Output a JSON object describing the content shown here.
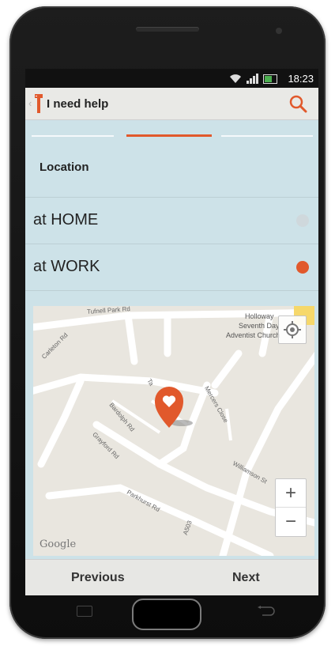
{
  "status_bar": {
    "time": "18:23"
  },
  "app_bar": {
    "back_glyph": "‹",
    "title": "I need help",
    "logo_icon": "help-logo-icon",
    "search_icon": "search-icon"
  },
  "tabs": {
    "active_index": 1,
    "count": 3
  },
  "section": {
    "title": "Location"
  },
  "options": [
    {
      "label": "at HOME",
      "selected": false
    },
    {
      "label": "at WORK",
      "selected": true
    }
  ],
  "map": {
    "labels": {
      "tufnell": "Tufnell Park Rd",
      "carleton": "Carleton Rd",
      "holloway_1": "Holloway",
      "holloway_2": "Seventh Day",
      "holloway_3": "Adventist Church",
      "bardsley": "Bardolph Rd",
      "grayford": "Grayford Rd",
      "parkhurst": "Parkhurst Rd",
      "mercers": "Mercers Close",
      "williamson": "Williamson St",
      "a503": "A503",
      "ta": "Ta"
    },
    "attribution": "Google",
    "zoom_in": "+",
    "zoom_out": "−"
  },
  "buttons": {
    "previous": "Previous",
    "next": "Next"
  },
  "colors": {
    "accent": "#e1592c",
    "screen_bg": "#cde2e8",
    "unselected_dot": "#cfd8dc"
  }
}
